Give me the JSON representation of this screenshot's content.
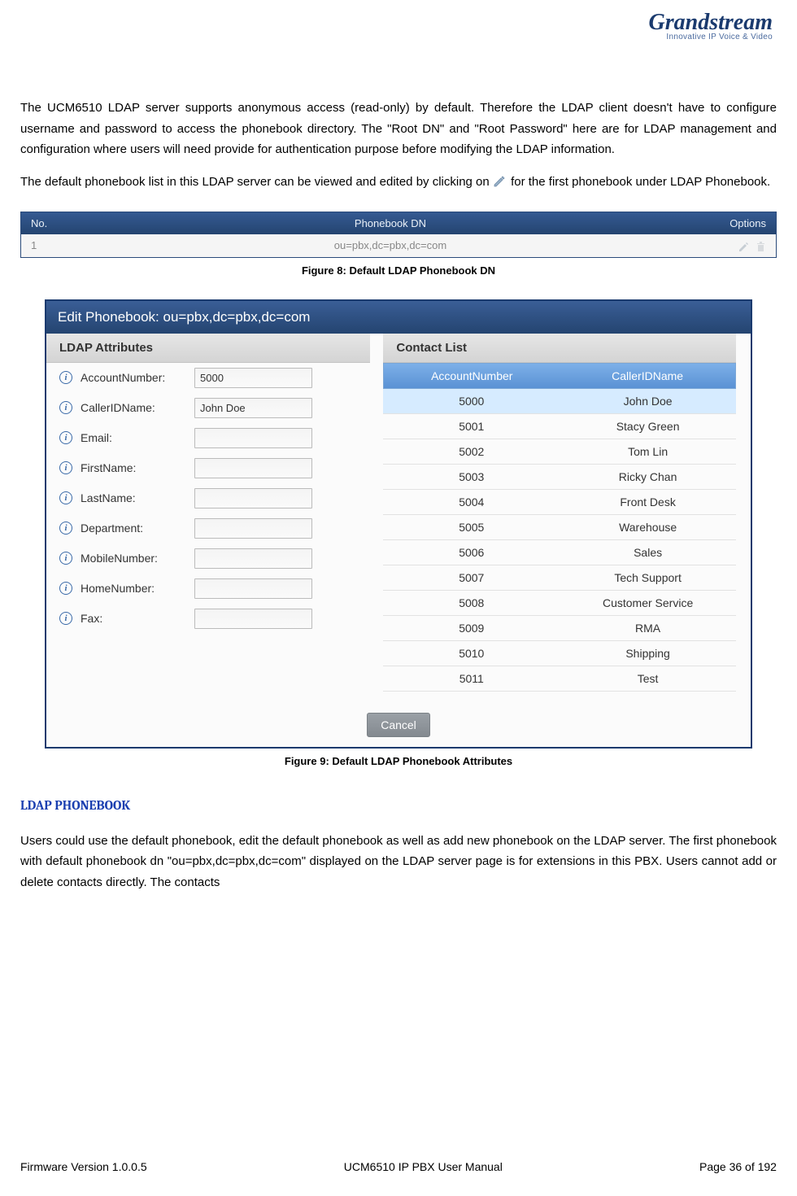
{
  "logo": {
    "brand": "Grandstream",
    "tagline": "Innovative IP Voice & Video"
  },
  "para1": "The UCM6510 LDAP server supports anonymous access (read-only) by default. Therefore the LDAP client doesn't have to configure username and password to access the phonebook directory. The \"Root DN\" and \"Root Password\" here are for LDAP management and configuration where users will need provide for authentication purpose before modifying the LDAP information.",
  "para2a": "The default phonebook list in this LDAP server can be viewed and edited by clicking on ",
  "para2b": " for the first phonebook under LDAP Phonebook.",
  "fig8": {
    "headers": {
      "no": "No.",
      "dn": "Phonebook DN",
      "options": "Options"
    },
    "row": {
      "no": "1",
      "dn": "ou=pbx,dc=pbx,dc=com"
    },
    "caption": "Figure 8: Default LDAP Phonebook DN"
  },
  "fig9": {
    "title": "Edit Phonebook: ou=pbx,dc=pbx,dc=com",
    "left_header": "LDAP Attributes",
    "right_header": "Contact List",
    "attrs": [
      {
        "label": "AccountNumber:",
        "value": "5000"
      },
      {
        "label": "CallerIDName:",
        "value": "John Doe"
      },
      {
        "label": "Email:",
        "value": ""
      },
      {
        "label": "FirstName:",
        "value": ""
      },
      {
        "label": "LastName:",
        "value": ""
      },
      {
        "label": "Department:",
        "value": ""
      },
      {
        "label": "MobileNumber:",
        "value": ""
      },
      {
        "label": "HomeNumber:",
        "value": ""
      },
      {
        "label": "Fax:",
        "value": ""
      }
    ],
    "contact_headers": {
      "acct": "AccountNumber",
      "name": "CallerIDName"
    },
    "contacts": [
      {
        "acct": "5000",
        "name": "John Doe",
        "selected": true
      },
      {
        "acct": "5001",
        "name": "Stacy Green"
      },
      {
        "acct": "5002",
        "name": "Tom Lin"
      },
      {
        "acct": "5003",
        "name": "Ricky Chan"
      },
      {
        "acct": "5004",
        "name": "Front Desk"
      },
      {
        "acct": "5005",
        "name": "Warehouse"
      },
      {
        "acct": "5006",
        "name": "Sales"
      },
      {
        "acct": "5007",
        "name": "Tech Support"
      },
      {
        "acct": "5008",
        "name": "Customer Service"
      },
      {
        "acct": "5009",
        "name": "RMA"
      },
      {
        "acct": "5010",
        "name": "Shipping"
      },
      {
        "acct": "5011",
        "name": "Test"
      }
    ],
    "cancel": "Cancel",
    "caption": "Figure 9: Default LDAP Phonebook Attributes"
  },
  "section_heading": "LDAP PHONEBOOK",
  "para3": "Users could use the default phonebook, edit the default phonebook as well as add new phonebook on the LDAP server. The first phonebook with default phonebook dn \"ou=pbx,dc=pbx,dc=com\" displayed on the LDAP server page is for extensions in this PBX. Users cannot add or delete contacts directly. The contacts",
  "footer": {
    "left": "Firmware Version 1.0.0.5",
    "center": "UCM6510 IP PBX User Manual",
    "right": "Page 36 of 192"
  }
}
